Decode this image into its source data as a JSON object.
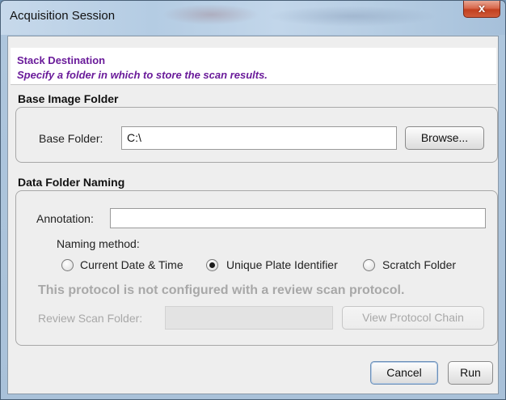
{
  "window": {
    "title": "Acquisition Session",
    "close_glyph": "x"
  },
  "header": {
    "title": "Stack Destination",
    "subtitle": "Specify a folder in which to store the scan results."
  },
  "base_image": {
    "section_title": "Base Image Folder",
    "folder_label": "Base Folder:",
    "folder_value": "C:\\",
    "browse_label": "Browse..."
  },
  "data_folder": {
    "section_title": "Data Folder Naming",
    "annotation_label": "Annotation:",
    "annotation_value": "",
    "naming_method_label": "Naming method:",
    "naming_options": [
      {
        "label": "Current Date & Time",
        "checked": false
      },
      {
        "label": "Unique Plate Identifier",
        "checked": true
      },
      {
        "label": "Scratch Folder",
        "checked": false
      }
    ],
    "warning": "This protocol is not configured with a review scan protocol.",
    "review_label": "Review Scan Folder:",
    "review_value": "",
    "view_chain_label": "View Protocol Chain"
  },
  "footer": {
    "cancel_label": "Cancel",
    "run_label": "Run"
  }
}
